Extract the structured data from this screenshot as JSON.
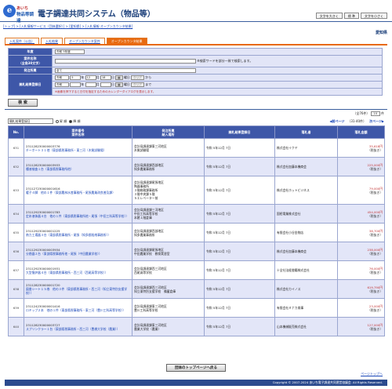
{
  "header": {
    "logo_top": "あいち",
    "logo_bottom": "物品等調達",
    "title": "電子調達共同システム（物品等）",
    "font_buttons": [
      "文字を大きく",
      "標 準",
      "文字を小さく"
    ]
  },
  "breadcrumb": "[トップ] > [入札情報サービス（団体選択）] > [愛知県] > [入札情報 オープンカウンタ結果]",
  "area": "愛知県",
  "tabs": [
    "入札案件（公告）",
    "入札結果",
    "オープンカウンタ案件",
    "オープンカウンタ結果"
  ],
  "form": {
    "year_label": "年度",
    "year_value": "令和 5年度",
    "name_label": "案件名称",
    "name_sub": "（全角30文字）",
    "name_note": "※検索ワードを部分一致で検索します。",
    "org_label": "発注所属",
    "org_value": "全て",
    "date_label": "開札結果登録日",
    "from": {
      "era": "令和",
      "y": "5",
      "m": "12",
      "d": "18"
    },
    "to": {
      "era": "令和",
      "y": "",
      "m": "",
      "d": ""
    },
    "year_unit": "年",
    "month_unit": "月",
    "day_unit": "日",
    "cal_label": "曜日",
    "clear_label": "クリア",
    "from_suffix": "から",
    "to_suffix": "まで",
    "note": "※画像を押下すると日付を指定するためのカレンダーダイアログを表示します。"
  },
  "search_button": "検 索",
  "sort": {
    "value": "開札結果登録日",
    "asc": "昇 順",
    "desc": "降 順"
  },
  "paging": {
    "count": "（全76件）",
    "per_page": "10",
    "per_label": "件",
    "summary": "（31-40件）",
    "prev": "前ページ",
    "next": "次ページ"
  },
  "table": {
    "headers": [
      "No.",
      "案件番号",
      "案件名称",
      "発注所属",
      "納入場所",
      "開札結果登録日",
      "落札者",
      "落札金額"
    ],
    "rows": [
      {
        "no": "631",
        "num": "231128230000003776",
        "name": "チーポート３１他（東部県税事務所・東三河（木質試験場）",
        "org": "会計局調達課東三河地区",
        "place": "木質試験場",
        "date": "令和 5年12月 7日",
        "winner": "株式会社イクヤ",
        "price": "35,618円",
        "tax": "（税抜き）"
      },
      {
        "no": "632",
        "num": "231128230000003933",
        "name": "種液検査１台（東部県税事務所他）",
        "org": "会計局調達課西部地区",
        "place": "知多農業事務所",
        "date": "令和 5年12月 7日",
        "winner": "株式会社加藤本機商会",
        "price": "225,000円",
        "tax": "（税抜き）"
      },
      {
        "no": "633",
        "num": "231127230000001616",
        "name": "暖子４脚　他の１件（東部農林水産事務所・尾張農業改良普及課）",
        "org": "会計局調達課尾張地区",
        "place": "陶器事務所\n３階総務課事務所\n３階中央課５階\n５エレベーター前",
        "date": "令和 5年12月 7日",
        "winner": "株式会社ホットビジネス",
        "price": "79,000円",
        "tax": "（税抜き）"
      },
      {
        "no": "634",
        "num": "231129230000001783",
        "name": "定氷液体器４台　他の１件（東部県税事務所他・尾張（中田工科高等学校））",
        "org": "会計局調達課三河地区",
        "place": "中田工科高等学校\n本館１階倉庫",
        "date": "令和 5年12月 7日",
        "winner": "国栢電業株式会社",
        "price": "454,000円",
        "tax": "（税抜き）"
      },
      {
        "no": "635",
        "num": "231129230000001225",
        "name": "南力工場器３台（東部県税事務所・尾張（知多郡旭南事務所））",
        "org": "会計局調達課西部地区",
        "place": "知多農業事務所",
        "date": "令和 5年12月 7日",
        "winner": "有限会社小谷金物店",
        "price": "38,700円",
        "tax": "（税抜き）"
      },
      {
        "no": "636",
        "num": "231129230000003934",
        "name": "分娩器２台（東部県税事務所他・尾張（中田農業学校））",
        "org": "会計局調達課尾張地区",
        "place": "中田農業学校　教育実習室",
        "date": "令和 5年12月 7日",
        "winner": "株式会社加藤本機商会",
        "price": "238,000円",
        "tax": "（税抜き）"
      },
      {
        "no": "637",
        "num": "231129230000001931",
        "name": "大型懐炉器４台（東部県税事務所・西三河（西尾高等学校））",
        "org": "会計局調達課西三河地区",
        "place": "西尾高等学校",
        "date": "令和 5年12月 7日",
        "winner": "十全社法経書籍株式会社",
        "price": "76,000円",
        "tax": "（税抜き）"
      },
      {
        "no": "638",
        "num": "231128230000001720",
        "name": "図書シート１５巻　他の３件（東部県税事務所・西三河（知立東特別支援学校））",
        "org": "会計局調達課西三河地区",
        "place": "知立東特別支援学校　備蓄倉庫",
        "date": "令和 5年12月 7日",
        "winner": "株式会社カイノス",
        "price": "619,790円",
        "tax": "（税抜き）"
      },
      {
        "no": "639",
        "num": "231124230000001416",
        "name": "ロキップ２本　他の１件（東部県税事務所・東三河（豊川工科高等学校））",
        "org": "会計局調達課東三河地区",
        "place": "豊川工科高等学校",
        "date": "令和 5年12月 7日",
        "winner": "有限会社ミナカ商事",
        "price": "23,000円",
        "tax": "（税抜き）"
      },
      {
        "no": "640",
        "num": "231128230000003727",
        "name": "スプリンクラー１台（東部県税事務所・西三河（豊橋大学校（農業））",
        "org": "会計局調達課東三河地区",
        "place": "農業大学校（農業）",
        "date": "令和 5年12月 7日",
        "winner": "山本機械販売株式会社",
        "price": "127,000円",
        "tax": "（税抜き）"
      }
    ]
  },
  "back_button": "団体のトップページへ戻る",
  "page_top": "ページトップへ",
  "footer": "Copyright © 2007-2024 あいち電子調達共同運営協議会. All Rights Reserved.",
  "colors": {
    "header_blue": "#3e57a8",
    "tab_orange": "#e86a10",
    "row_alt": "#e3e6f8",
    "price_red": "#c03030"
  }
}
